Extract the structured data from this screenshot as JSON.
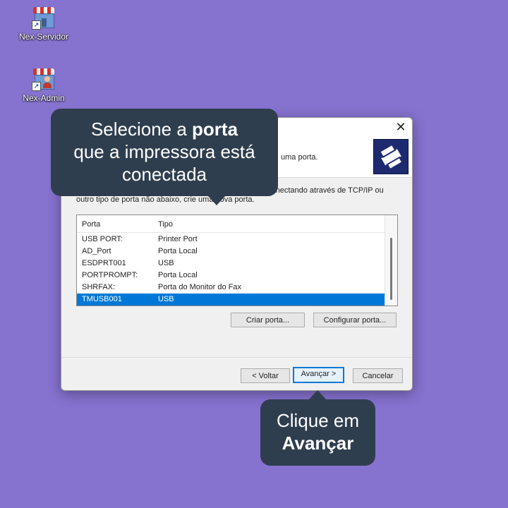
{
  "desktop": {
    "icons": [
      {
        "label": "Nex-Servidor"
      },
      {
        "label": "Nex-Admin"
      }
    ]
  },
  "dialog": {
    "close_glyph": "✕",
    "header_text": "uma porta.",
    "description_line1_right": "conectando através de TCP/IP ou",
    "description_line2": "outro tipo de porta não      abaixo, crie uma nova porta.",
    "columns": [
      "Porta",
      "Tipo"
    ],
    "rows": [
      {
        "porta": "USB PORT:",
        "tipo": "Printer Port"
      },
      {
        "porta": "AD_Port",
        "tipo": "Porta Local"
      },
      {
        "porta": "ESDPRT001",
        "tipo": "USB"
      },
      {
        "porta": "PORTPROMPT:",
        "tipo": "Porta Local"
      },
      {
        "porta": "SHRFAX:",
        "tipo": "Porta do Monitor do Fax"
      },
      {
        "porta": "TMUSB001",
        "tipo": "USB"
      }
    ],
    "selected_row": "TMUSB001",
    "buttons": {
      "create_port": "Criar porta...",
      "configure_port": "Configurar porta...",
      "back": "< Voltar",
      "next": "Avançar >",
      "cancel": "Cancelar"
    }
  },
  "callouts": {
    "top": {
      "line1_pre": "Selecione a ",
      "line1_bold": "porta",
      "line2": "que a impressora está",
      "line3": "conectada"
    },
    "bottom": {
      "line1": "Clique em",
      "line2_bold": "Avançar"
    }
  },
  "colors": {
    "desktop_bg": "#8672cf",
    "callout_bg": "#2f3e4e",
    "selection": "#0078d7"
  }
}
